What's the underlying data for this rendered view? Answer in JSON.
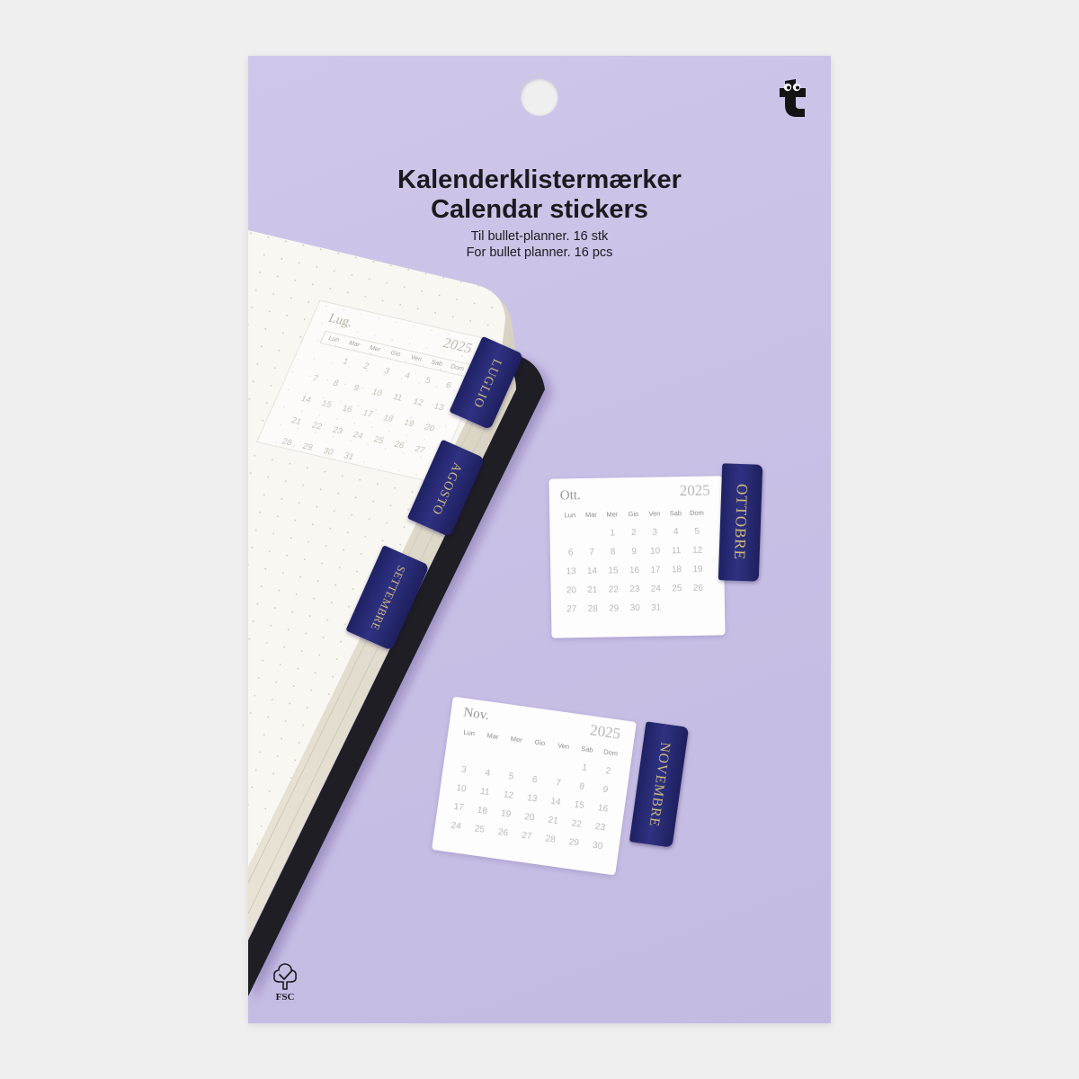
{
  "package": {
    "title_da": "Kalenderklistermærker",
    "title_en": "Calendar stickers",
    "subtitle_da": "Til bullet-planner. 16 stk",
    "subtitle_en": "For bullet planner. 16 pcs"
  },
  "brand": {
    "logo_icon": "flying-tiger-t-logo"
  },
  "tabs": {
    "luglio": "LUGLIO",
    "agosto": "AGOSTO",
    "settembre": "SETTEMBRE",
    "ottobre": "OTTOBRE",
    "novembre": "NOVEMBRE"
  },
  "calendars": {
    "luglio": {
      "month": "Lug.",
      "year": "2025",
      "weekdays": [
        "Lun",
        "Mar",
        "Mer",
        "Gio",
        "Ven",
        "Sab",
        "Dom"
      ],
      "weeks": [
        [
          "",
          "1",
          "2",
          "3",
          "4",
          "5",
          "6"
        ],
        [
          "7",
          "8",
          "9",
          "10",
          "11",
          "12",
          "13"
        ],
        [
          "14",
          "15",
          "16",
          "17",
          "18",
          "19",
          "20"
        ],
        [
          "21",
          "22",
          "23",
          "24",
          "25",
          "26",
          "27"
        ],
        [
          "28",
          "29",
          "30",
          "31",
          "",
          "",
          ""
        ]
      ]
    },
    "ottobre": {
      "month": "Ott.",
      "year": "2025",
      "weekdays": [
        "Lun",
        "Mar",
        "Mer",
        "Gio",
        "Ven",
        "Sab",
        "Dom"
      ],
      "weeks": [
        [
          "",
          "",
          "1",
          "2",
          "3",
          "4",
          "5"
        ],
        [
          "6",
          "7",
          "8",
          "9",
          "10",
          "11",
          "12"
        ],
        [
          "13",
          "14",
          "15",
          "16",
          "17",
          "18",
          "19"
        ],
        [
          "20",
          "21",
          "22",
          "23",
          "24",
          "25",
          "26"
        ],
        [
          "27",
          "28",
          "29",
          "30",
          "31",
          "",
          ""
        ]
      ]
    },
    "novembre": {
      "month": "Nov.",
      "year": "2025",
      "weekdays": [
        "Lun",
        "Mar",
        "Mer",
        "Gio",
        "Ven",
        "Sab",
        "Dom"
      ],
      "weeks": [
        [
          "",
          "",
          "",
          "",
          "",
          "1",
          "2"
        ],
        [
          "3",
          "4",
          "5",
          "6",
          "7",
          "8",
          "9"
        ],
        [
          "10",
          "11",
          "12",
          "13",
          "14",
          "15",
          "16"
        ],
        [
          "17",
          "18",
          "19",
          "20",
          "21",
          "22",
          "23"
        ],
        [
          "24",
          "25",
          "26",
          "27",
          "28",
          "29",
          "30"
        ]
      ]
    }
  },
  "certification": {
    "label": "FSC",
    "icon": "fsc-tree-icon"
  },
  "colors": {
    "background": "#efefef",
    "card": "#c9c0e6",
    "title": "#1b1b1f",
    "tab": "#282a72",
    "tab_text": "#cdb97f",
    "notebook_cover": "#1e1e24",
    "notebook_page": "#f8f7f2"
  }
}
